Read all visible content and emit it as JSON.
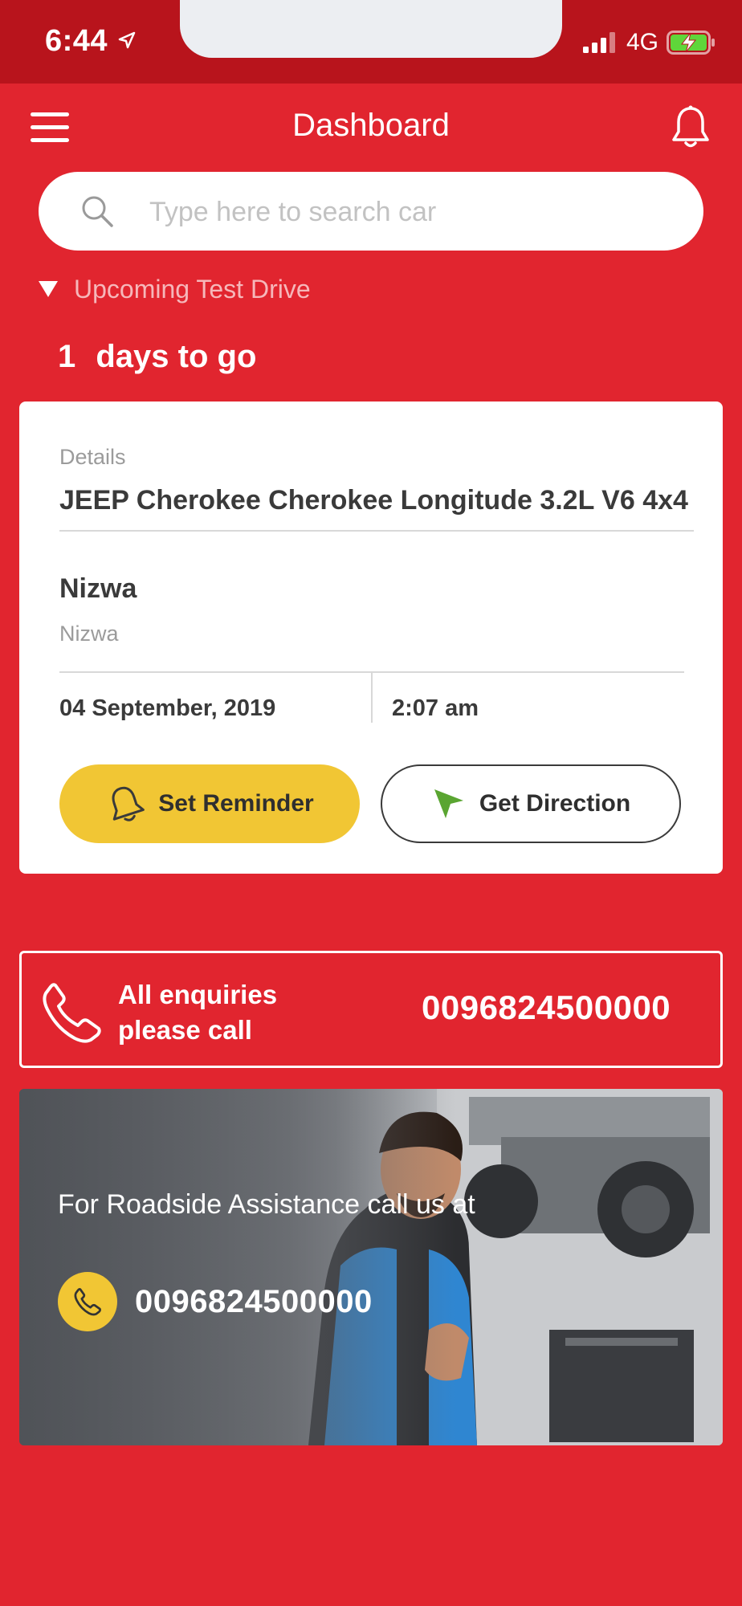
{
  "status_bar": {
    "time": "6:44",
    "network": "4G",
    "icons": [
      "location-arrow-icon",
      "signal-icon",
      "battery-charging-icon"
    ]
  },
  "header": {
    "title": "Dashboard",
    "icons": [
      "hamburger-menu-icon",
      "bell-icon"
    ]
  },
  "search": {
    "placeholder": "Type here to search car",
    "value": "",
    "icon": "search-icon"
  },
  "upcoming": {
    "toggle_label": "Upcoming Test Drive",
    "days_count": "1",
    "days_suffix": "days to go"
  },
  "test_drive_card": {
    "details_label": "Details",
    "car_name": "JEEP Cherokee Cherokee Longitude 3.2L V6 4x4",
    "location_title": "Nizwa",
    "location_subtitle": "Nizwa",
    "date": "04 September, 2019",
    "time": "2:07 am",
    "reminder_button": "Set Reminder",
    "direction_button": "Get Direction"
  },
  "enquiry": {
    "text_line1": "All enquiries",
    "text_line2": "please call",
    "phone": "0096824500000",
    "icon": "phone-icon"
  },
  "roadside": {
    "text": "For Roadside Assistance call us at",
    "phone": "0096824500000",
    "icon": "phone-icon"
  },
  "colors": {
    "background": "#e1252f",
    "status_bar": "#b8141c",
    "accent_yellow": "#f1c634",
    "direction_green": "#5aa531"
  }
}
